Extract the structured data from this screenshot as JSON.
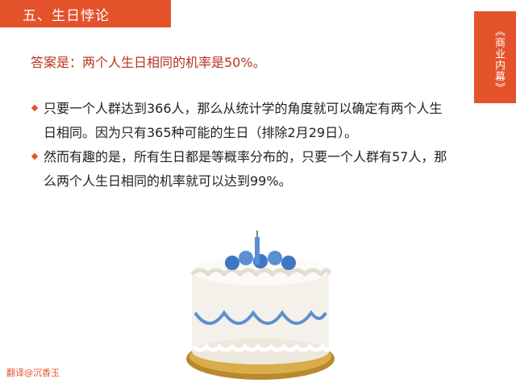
{
  "slide": {
    "title": "五、生日悖论",
    "side_label": "《商业内幕》",
    "answer": "答案是：两个人生日相同的机率是50%。",
    "bullets": [
      "只要一个人群达到366人，那么从统计学的角度就可以确定有两个人生日相同。因为只有365种可能的生日（排除2月29日）。",
      "然而有趣的是，所有生日都是等概率分布的，只要一个人群有57人，那么两个人生日相同的机率就可以达到99%。"
    ],
    "credit": "翻译@沉香玉"
  },
  "colors": {
    "accent": "#e4522b",
    "answer_text": "#b8331b"
  },
  "icons": [
    "diamond-bullet-icon",
    "birthday-cake-illustration"
  ]
}
